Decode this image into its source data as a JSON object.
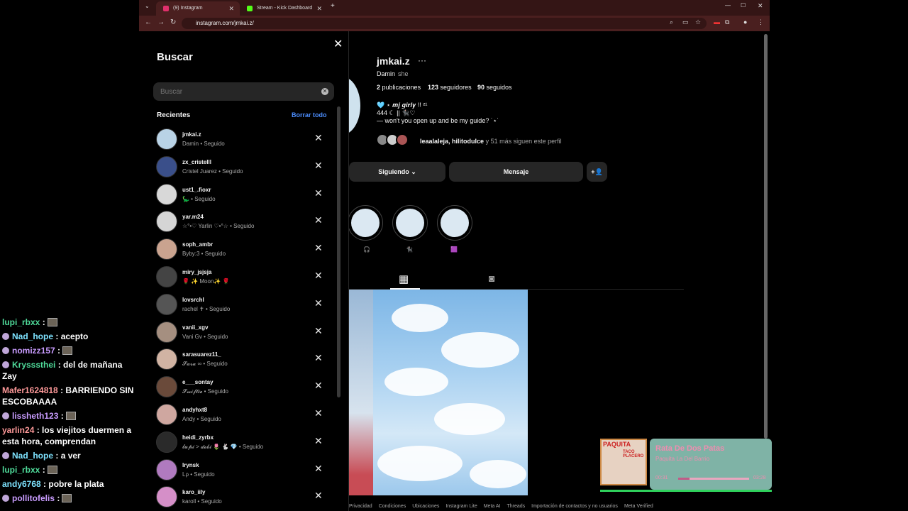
{
  "chat": [
    {
      "user": "lupi_rbxx",
      "color": "#4fdb9a",
      "text": ":",
      "emote": true,
      "badge": false
    },
    {
      "user": "Nad_hope",
      "color": "#7ee3ff",
      "text": ": acepto",
      "emote": false,
      "badge": true
    },
    {
      "user": "nomizz157",
      "color": "#c99cff",
      "text": ":",
      "emote": true,
      "badge": true
    },
    {
      "user": "Kryssstheі",
      "color": "#4fdb9a",
      "text": ": del de mañana Zay",
      "emote": false,
      "badge": true
    },
    {
      "user": "Mafer1624818",
      "color": "#ff9a9a",
      "text": ": BARRIENDO SIN ESCOBAAAA",
      "emote": false,
      "badge": false
    },
    {
      "user": "lissheth123",
      "color": "#c99cff",
      "text": ":",
      "emote": true,
      "badge": true
    },
    {
      "user": "yarlin24",
      "color": "#ff9a9a",
      "text": ": los viejitos duermen a esta hora, comprendan",
      "emote": false,
      "badge": false
    },
    {
      "user": "Nad_hope",
      "color": "#7ee3ff",
      "text": ": a ver",
      "emote": false,
      "badge": true
    },
    {
      "user": "lupi_rbxx",
      "color": "#4fdb9a",
      "text": ":",
      "emote": true,
      "badge": false
    },
    {
      "user": "andy6768",
      "color": "#7ee3ff",
      "text": ": pobre la plata",
      "emote": false,
      "badge": false
    },
    {
      "user": "pollitofelis",
      "color": "#c99cff",
      "text": ":",
      "emote": true,
      "badge": true
    }
  ],
  "browser": {
    "tabs": [
      {
        "title": "(9) Instagram",
        "active": true,
        "favicon_color": "#e1306c"
      },
      {
        "title": "Stream - Kick Dashboard",
        "active": false,
        "favicon_color": "#53fc18"
      }
    ],
    "url": "instagram.com/jmkai.z/"
  },
  "search": {
    "title": "Buscar",
    "placeholder": "Buscar",
    "recent_heading": "Recientes",
    "clear_all": "Borrar todo",
    "recents": [
      {
        "username": "jmkai.z",
        "sub": "Damin • Seguido"
      },
      {
        "username": "zx_cristelll",
        "sub": "Cristel Juarez • Seguido"
      },
      {
        "username": "ust1_.fioxr",
        "sub": "🦕 • Seguido"
      },
      {
        "username": "yar.m24",
        "sub": "☆°•♡ Yarlin ♡•°☆ • Seguido"
      },
      {
        "username": "soph_ambr",
        "sub": "Byby:3 • Seguido"
      },
      {
        "username": "miry_jsjsja",
        "sub": "🌹 ✨ Moon✨ 🌹"
      },
      {
        "username": "lovsrchl",
        "sub": "rachel ✝ • Seguido"
      },
      {
        "username": "vanii_xgv",
        "sub": "Vani Gv • Seguido"
      },
      {
        "username": "sarasuarez11_",
        "sub": "𝓢𝓪𝓻𝓪 ∞ • Seguido"
      },
      {
        "username": "e___sontay",
        "sub": "𝓢𝔀𝓲𝓯𝓽𝓲𝓮 • Seguido"
      },
      {
        "username": "andyhxt8",
        "sub": "Andy • Seguido"
      },
      {
        "username": "heidi_zyrbx",
        "sub": "𝓵𝓾𝓹𝓲 > 𝓭𝓮𝓫𝓲 🌷 🐇 💎 • Seguido"
      },
      {
        "username": "lrynsk",
        "sub": "Lρ • Seguido"
      },
      {
        "username": "karo_iily",
        "sub": "karoll • Seguido"
      }
    ]
  },
  "profile": {
    "username": "jmkai.z",
    "more": "···",
    "full_name": "Damin",
    "pronoun": "she",
    "posts": "2",
    "posts_label": "publicaciones",
    "followers": "123",
    "followers_label": "seguidores",
    "following": "90",
    "following_label": "seguidos",
    "bio1": "🩵 ⋆ 𝒎𝒋 𝒈𝒊𝒓𝒍𝒚 !! ²¹",
    "bio2": "444 ☾ || 🐈‍⬛♡",
    "bio3": "— won't you open up and be my guide? ˙⋆˙",
    "followed_by_names": "leaalaleja, hilitodulce",
    "followed_by_rest": "y 51 más siguen este perfil",
    "btn_following": "Siguiendo ⌄",
    "btn_message": "Mensaje",
    "btn_add": "+👤",
    "highlights": [
      "🎧",
      "🐈‍⬛",
      "🟪"
    ],
    "tab_grid_icon": "▦",
    "tab_tagged_icon": "◙"
  },
  "footer": [
    "Privacidad",
    "Condiciones",
    "Ubicaciones",
    "Instagram Lite",
    "Meta AI",
    "Threads",
    "Importación de contactos y no usuarios",
    "Meta Verified"
  ],
  "music": {
    "album_title": "PAQUITA",
    "album_sub": "TACO PLACERO",
    "song": "Rata De Dos Patas",
    "artist": "Paquita La Del Barrio",
    "time_start": "00:31",
    "time_end": "03:28",
    "progress": 0.16
  }
}
